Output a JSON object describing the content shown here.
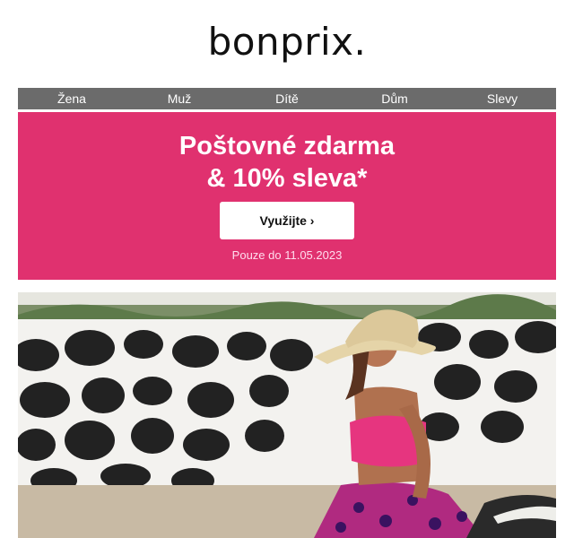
{
  "brand": {
    "logo": "bonprix."
  },
  "nav": [
    "Žena",
    "Muž",
    "Dítě",
    "Dům",
    "Slevy"
  ],
  "promo": {
    "line1": "Poštovné zdarma",
    "line2": "& 10% sleva*",
    "cta": "Využijte ›",
    "validity": "Pouze do 11.05.2023",
    "color": "#e0316f"
  },
  "hero": {
    "alt": "woman-in-pink-swimwear-and-straw-hat"
  }
}
